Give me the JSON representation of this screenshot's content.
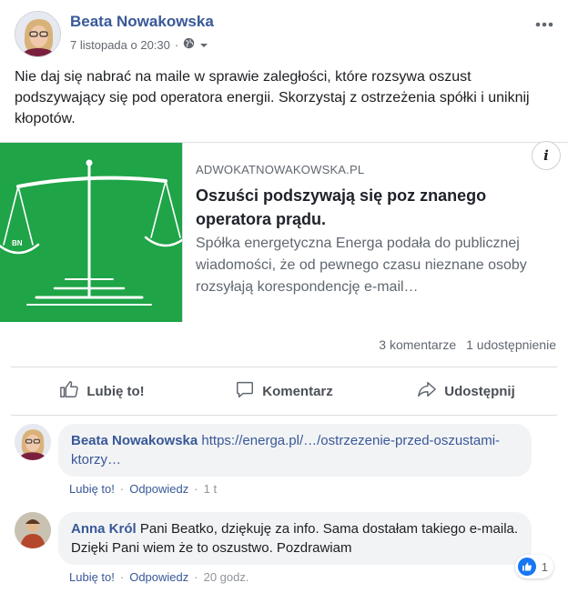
{
  "post": {
    "author": "Beata Nowakowska",
    "timestamp": "7 listopada o 20:30",
    "separator": "·",
    "privacy_icon": "globe-icon",
    "menu_icon": "more-dots-icon",
    "text": "Nie daj się nabrać na maile w sprawie zaległości, które rozsywa oszust podszywający się pod operatora energii. Skorzystaj z ostrzeżenia spółki i uniknij kłopotów."
  },
  "link_card": {
    "image_badge": "BN",
    "domain": "ADWOKATNOWAKOWSKA.PL",
    "title": "Oszuści podszywają się poz znanego operatora prądu.",
    "description": "Spółka energetyczna Energa podała do publicznej wiadomości, że od pewnego czasu nieznane osoby rozsyłają korespondencję e-mail…",
    "info_label": "i",
    "image_bg": "#1fa447"
  },
  "counts": {
    "comments": "3 komentarze",
    "shares": "1 udostępnienie"
  },
  "actions": {
    "like": "Lubię to!",
    "comment": "Komentarz",
    "share": "Udostępnij"
  },
  "comments": [
    {
      "author": "Beata Nowakowska",
      "link": "https://energa.pl/…/ostrzezenie-przed-oszustami-ktorzy…",
      "text": "",
      "like": "Lubię to!",
      "reply": "Odpowiedz",
      "time": "1 t"
    },
    {
      "author": "Anna Król",
      "link": "",
      "text": "Pani Beatko, dziękuję za info. Sama dostałam takiego e-maila. Dzięki Pani wiem że to oszustwo. Pozdrawiam",
      "like": "Lubię to!",
      "reply": "Odpowiedz",
      "time": "20 godz.",
      "reactions": "1"
    }
  ],
  "colors": {
    "link_blue": "#385898",
    "like_blue": "#1877f2"
  }
}
